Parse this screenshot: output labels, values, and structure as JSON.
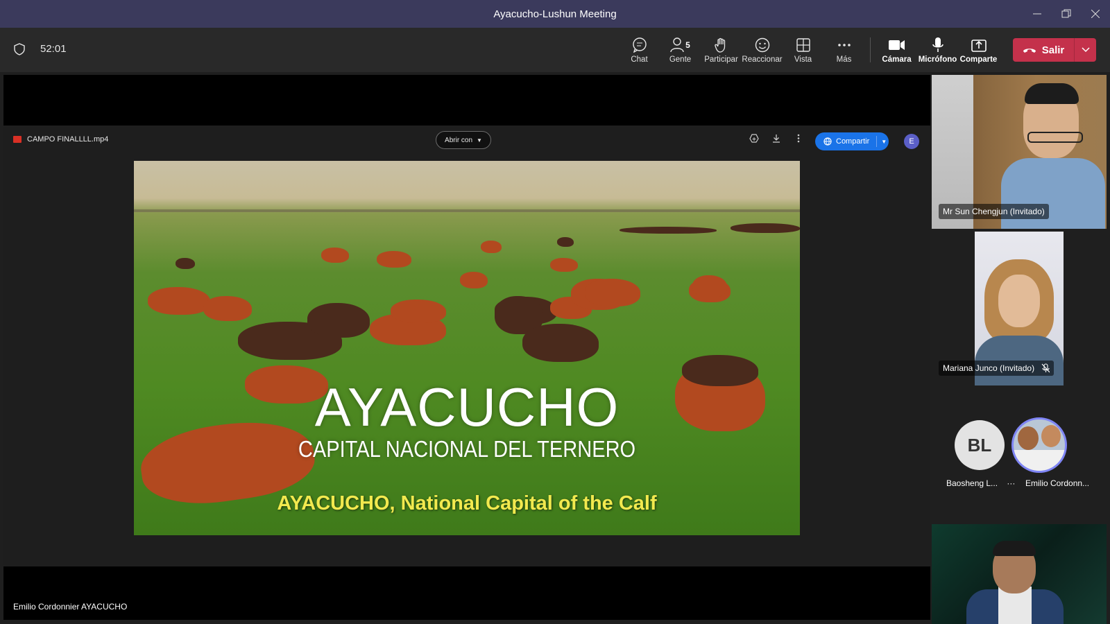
{
  "window": {
    "title": "Ayacucho-Lushun Meeting"
  },
  "toolbar": {
    "timer": "52:01",
    "people_count": "5",
    "items": {
      "chat": "Chat",
      "people": "Gente",
      "participate": "Participar",
      "react": "Reaccionar",
      "view": "Vista",
      "more": "Más",
      "camera": "Cámara",
      "mic": "Micrófono",
      "share": "Comparte"
    },
    "leave_label": "Salir"
  },
  "shared_content": {
    "file_name": "CAMPO FINALLLL.mp4",
    "open_with": "Abrir con",
    "share_button": "Compartir",
    "account_initial": "E",
    "video": {
      "title": "AYACUCHO",
      "subtitle": "CAPITAL NACIONAL DEL TERNERO",
      "caption": "AYACUCHO, National Capital of the Calf"
    },
    "presenter_name": "Emilio Cordonnier AYACUCHO"
  },
  "participants": [
    {
      "name": "Mr Sun Chengjun (Invitado)"
    },
    {
      "name": "Mariana Junco (Invitado)",
      "muted": true
    },
    {
      "name": "Baosheng L...",
      "initials": "BL",
      "more": "···"
    },
    {
      "name": "Emilio Cordonn..."
    }
  ],
  "colors": {
    "title_bar": "#3b3a5c",
    "leave_red": "#c4314b",
    "share_blue": "#1a73e8",
    "caption_yellow": "#f2e94e"
  }
}
